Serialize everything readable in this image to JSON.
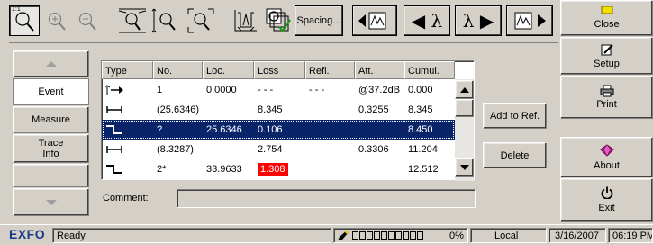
{
  "toolbar": {
    "zoom_reset_label": "1:1",
    "spacing_label": "Spacing...",
    "lambda_prev_label": "◀ λ",
    "lambda_next_label": "λ ▶"
  },
  "nav": {
    "items": [
      {
        "label": "Event",
        "active": true
      },
      {
        "label": "Measure",
        "active": false
      },
      {
        "label": "Trace\nInfo",
        "active": false
      }
    ]
  },
  "table": {
    "columns": [
      "Type",
      "No.",
      "Loc.",
      "Loss",
      "Refl.",
      "Att.",
      "Cumul."
    ],
    "rows": [
      {
        "type_icon": "launch-start-icon",
        "no": "1",
        "loc": "0.0000",
        "loss": "- - -",
        "refl": "- - -",
        "att": "@37.2dB",
        "cumul": "0.000",
        "selected": false,
        "loss_alert": false
      },
      {
        "type_icon": "span-segment-icon",
        "no": "(25.6346)",
        "loc": "",
        "loss": "8.345",
        "refl": "",
        "att": "0.3255",
        "cumul": "8.345",
        "selected": false,
        "loss_alert": false
      },
      {
        "type_icon": "nonreflective-event-icon",
        "no": "?",
        "loc": "25.6346",
        "loss": "0.106",
        "refl": "",
        "att": "",
        "cumul": "8.450",
        "selected": true,
        "loss_alert": false
      },
      {
        "type_icon": "span-segment-icon",
        "no": "(8.3287)",
        "loc": "",
        "loss": "2.754",
        "refl": "",
        "att": "0.3306",
        "cumul": "11.204",
        "selected": false,
        "loss_alert": false
      },
      {
        "type_icon": "nonreflective-event-icon",
        "no": "2*",
        "loc": "33.9633",
        "loss": "1.308",
        "refl": "",
        "att": "",
        "cumul": "12.512",
        "selected": false,
        "loss_alert": true
      }
    ]
  },
  "actions": {
    "add_to_ref": "Add to Ref.",
    "delete": "Delete"
  },
  "comment": {
    "label": "Comment:",
    "value": ""
  },
  "right_menu": [
    {
      "label": "Close",
      "icon": "close-folder-icon"
    },
    {
      "label": "Setup",
      "icon": "setup-pencil-icon"
    },
    {
      "label": "Print",
      "icon": "printer-icon"
    },
    {
      "label": "About",
      "icon": "about-gem-icon"
    },
    {
      "label": "Exit",
      "icon": "power-icon"
    }
  ],
  "status": {
    "brand": "EXFO",
    "ready": "Ready",
    "progress": "0%",
    "progress_fraction": 0,
    "mode": "Local",
    "date": "3/16/2007",
    "time": "06:19 PM"
  },
  "colors": {
    "selection": "#0a246a",
    "loss_alert": "#ff0000",
    "brand": "#1a3a8c"
  }
}
